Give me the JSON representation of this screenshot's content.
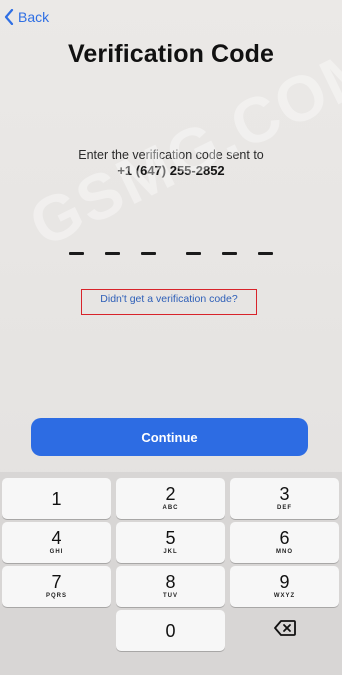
{
  "nav": {
    "back_label": "Back"
  },
  "page": {
    "title": "Verification Code",
    "instruction": "Enter the verification code sent to",
    "phone": "+1 (647) 255-2852",
    "code_value": "",
    "resend_link": "Didn't get a verification code?",
    "watermark": "GSMG.COM"
  },
  "actions": {
    "continue_label": "Continue"
  },
  "keypad": {
    "keys": [
      {
        "number": "1",
        "letters": ""
      },
      {
        "number": "2",
        "letters": "ABC"
      },
      {
        "number": "3",
        "letters": "DEF"
      },
      {
        "number": "4",
        "letters": "GHI"
      },
      {
        "number": "5",
        "letters": "JKL"
      },
      {
        "number": "6",
        "letters": "MNO"
      },
      {
        "number": "7",
        "letters": "PQRS"
      },
      {
        "number": "8",
        "letters": "TUV"
      },
      {
        "number": "9",
        "letters": "WXYZ"
      },
      {
        "number": "0",
        "letters": ""
      }
    ],
    "delete_icon": "backspace-icon"
  },
  "colors": {
    "accent": "#2d6ce3",
    "highlight": "#d8232a",
    "link": "#2e5fb8"
  }
}
